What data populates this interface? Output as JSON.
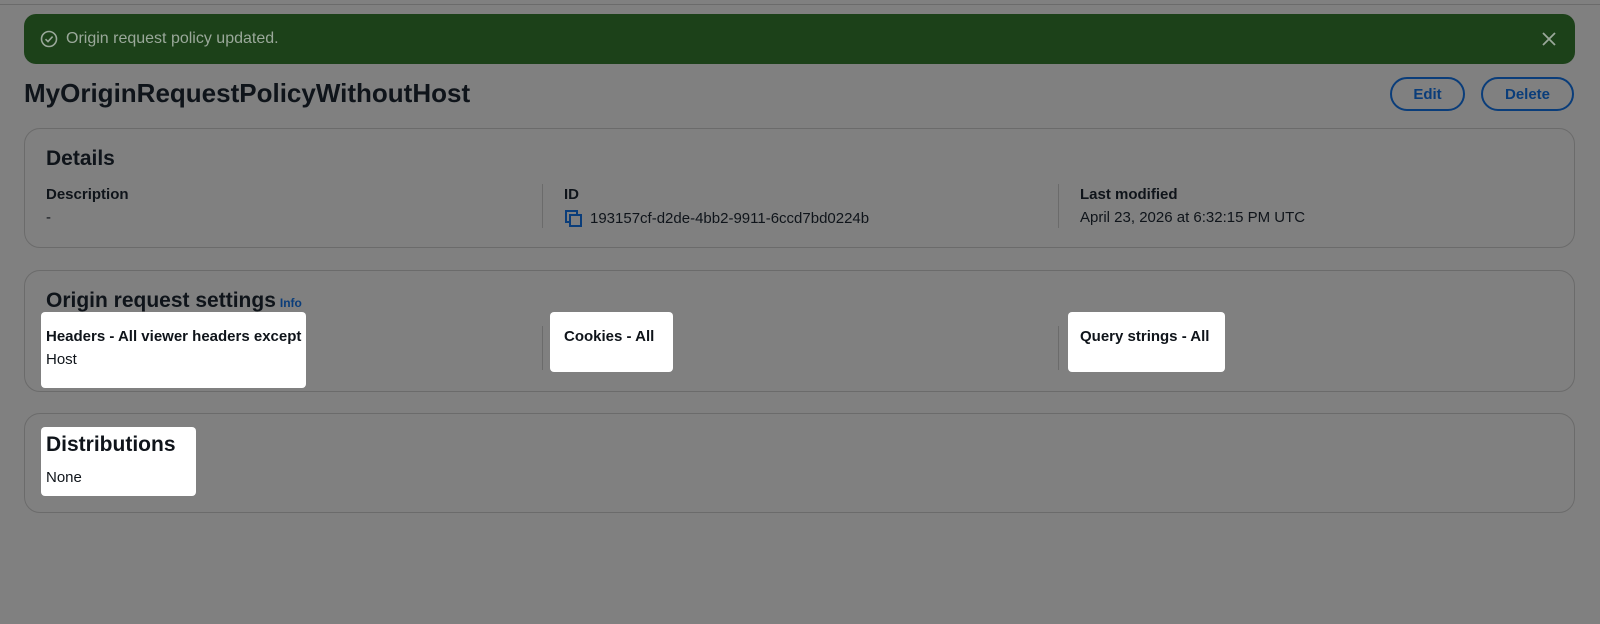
{
  "flash": {
    "message": "Origin request policy updated."
  },
  "page": {
    "title": "MyOriginRequestPolicyWithoutHost",
    "edit_label": "Edit",
    "delete_label": "Delete"
  },
  "details": {
    "heading": "Details",
    "description_label": "Description",
    "description_value": "-",
    "id_label": "ID",
    "id_value": "193157cf-d2de-4bb2-9911-6ccd7bd0224b",
    "last_modified_label": "Last modified",
    "last_modified_value": "April 23, 2026 at 6:32:15 PM UTC"
  },
  "settings": {
    "heading": "Origin request settings",
    "info_label": "Info",
    "headers_label": "Headers - All viewer headers except",
    "headers_value": "Host",
    "cookies_label": "Cookies - All",
    "query_strings_label": "Query strings - All"
  },
  "distributions": {
    "heading": "Distributions",
    "value": "None"
  },
  "colors": {
    "flash_bg": "#1c4119",
    "link": "#0a3d7a",
    "overlay": "#808080"
  }
}
